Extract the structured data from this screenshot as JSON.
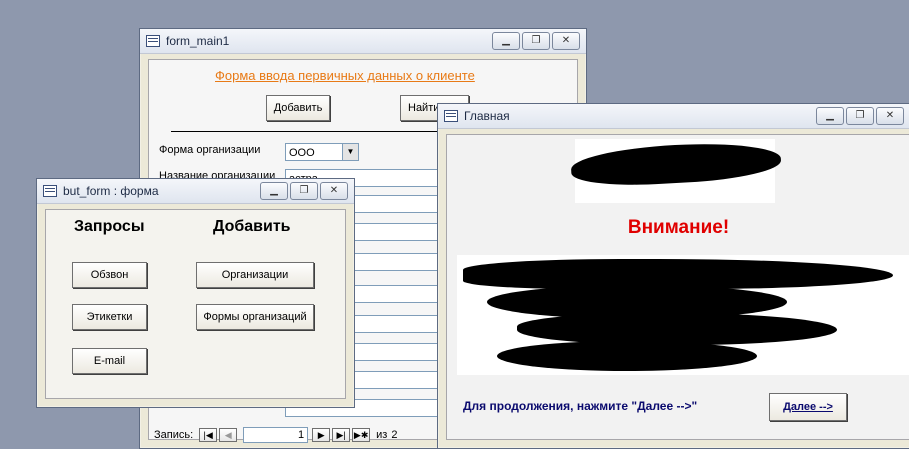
{
  "form_main1": {
    "title": "form_main1",
    "heading": "Форма ввода первичных данных о клиенте",
    "add_label": "Добавить",
    "find_label": "Найти",
    "org_form_label": "Форма организации",
    "org_form_value": "ООО",
    "org_name_label": "Название организации",
    "org_name_value": "астра",
    "record_label": "Запись:",
    "record_current": "1",
    "record_of": "из",
    "record_total": "2"
  },
  "but_form": {
    "title": "but_form : форма",
    "queries_heading": "Запросы",
    "add_heading": "Добавить",
    "btn_obzvon": "Обзвон",
    "btn_labels": "Этикетки",
    "btn_email": "E-mail",
    "btn_organizations": "Организации",
    "btn_org_forms": "Формы организаций"
  },
  "glavnaya": {
    "title": "Главная",
    "warning_heading": "Внимание!",
    "continue_text": "Для продолжения, нажмите \"Далее  -->\"",
    "next_label": "Далее -->"
  },
  "colors": {
    "warning": "#e00000",
    "heading_link": "#e87a16",
    "continue_text": "#0a0a6e"
  },
  "icons": {
    "window": "form-icon",
    "minimize": "minimize-icon",
    "maximize": "maximize-icon",
    "close": "close-icon"
  }
}
